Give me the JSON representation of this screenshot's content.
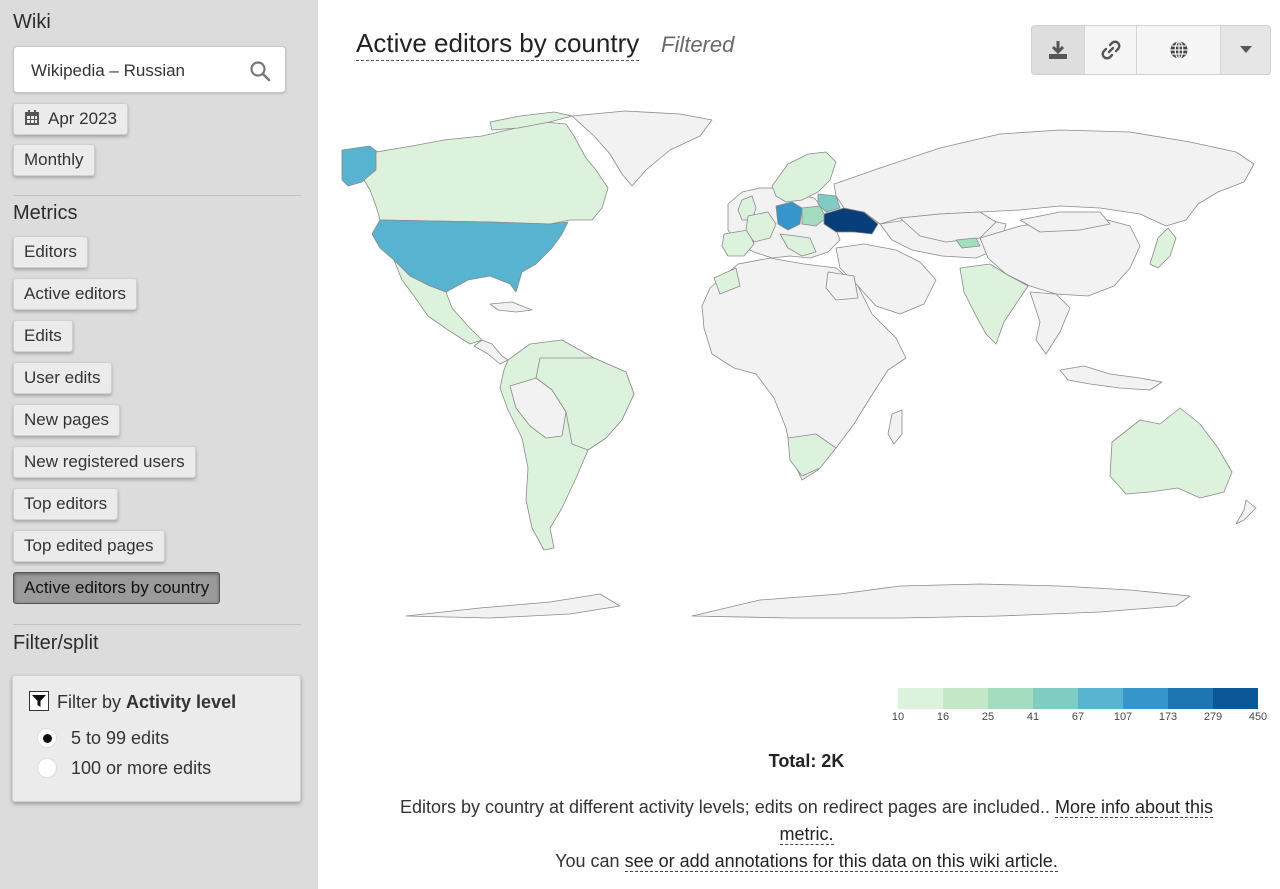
{
  "sidebar": {
    "wiki_heading": "Wiki",
    "wiki_value": "Wikipedia – Russian",
    "date_label": "Apr 2023",
    "granularity_label": "Monthly",
    "metrics_heading": "Metrics",
    "metrics": [
      {
        "label": "Editors",
        "active": false
      },
      {
        "label": "Active editors",
        "active": false
      },
      {
        "label": "Edits",
        "active": false
      },
      {
        "label": "User edits",
        "active": false
      },
      {
        "label": "New pages",
        "active": false
      },
      {
        "label": "New registered users",
        "active": false
      },
      {
        "label": "Top editors",
        "active": false
      },
      {
        "label": "Top edited pages",
        "active": false
      },
      {
        "label": "Active editors by country",
        "active": true
      }
    ],
    "filter_heading": "Filter/split",
    "filter": {
      "prefix": "Filter by",
      "name": "Activity level",
      "options": [
        {
          "label": "5 to 99 edits",
          "selected": true
        },
        {
          "label": "100 or more edits",
          "selected": false
        }
      ]
    }
  },
  "main": {
    "title": "Active editors by country",
    "subtitle": "Filtered",
    "toolbar": {
      "icons": [
        "download-icon",
        "link-icon",
        "globe-icon",
        "caret-down-icon"
      ]
    },
    "legend": {
      "ticks": [
        "10",
        "16",
        "25",
        "41",
        "67",
        "107",
        "173",
        "279",
        "450"
      ],
      "colors": [
        "#ddf2dc",
        "#c4e8c8",
        "#a4dcbf",
        "#80ccc3",
        "#57b3d0",
        "#3696c9",
        "#1d76b3",
        "#0b5699",
        "#083e7a"
      ]
    },
    "total": "Total: 2K",
    "description": "Editors by country at different activity levels; edits on redirect pages are included..",
    "more_info_link": "More info about this metric.",
    "annotations_prefix": "You can",
    "annotations_link": "see or add annotations for this data on this wiki article."
  },
  "colors": {
    "sidebar_bg": "#dcdcdc",
    "land_default": "#f2f2f2",
    "border": "#8a8a8a"
  }
}
